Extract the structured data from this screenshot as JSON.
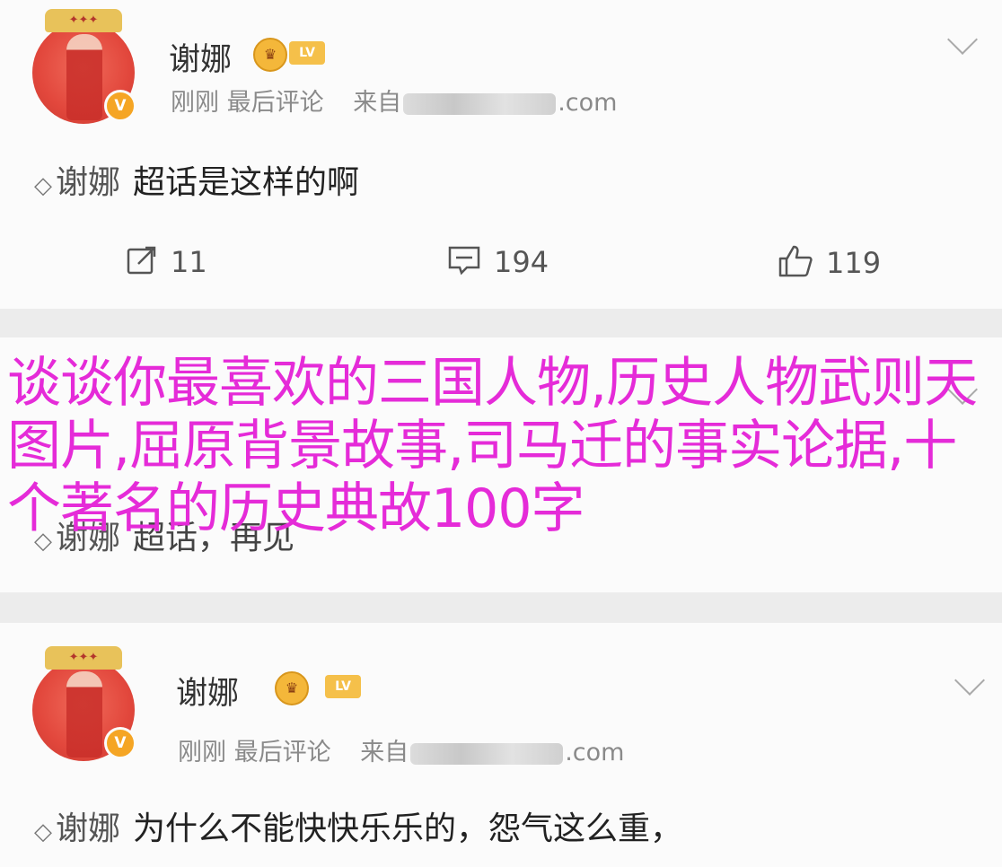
{
  "posts": [
    {
      "username": "谢娜",
      "time": "刚刚",
      "action": "最后评论",
      "source_prefix": "来自",
      "source_suffix": ".com",
      "topic": "谢娜",
      "text": "超话是这样的啊",
      "reposts": "11",
      "comments": "194",
      "likes": "119"
    },
    {
      "topic": "谢娜",
      "text": "超话，再见"
    },
    {
      "username": "谢娜",
      "time": "刚刚",
      "action": "最后评论",
      "source_prefix": "来自",
      "source_suffix": ".com",
      "topic": "谢娜",
      "text": "为什么不能快快乐乐的，怨气这么重，"
    }
  ],
  "overlay_title": "谈谈你最喜欢的三国人物,历史人物武则天图片,屈原背景故事,司马迁的事实论据,十个著名的历史典故100字",
  "colors": {
    "overlay": "#e52bd8",
    "badge": "#f4b73a",
    "avatar": "#e2473c"
  },
  "icons": [
    "repost-icon",
    "comment-icon",
    "like-icon",
    "chevron-down-icon",
    "supertopic-icon"
  ]
}
